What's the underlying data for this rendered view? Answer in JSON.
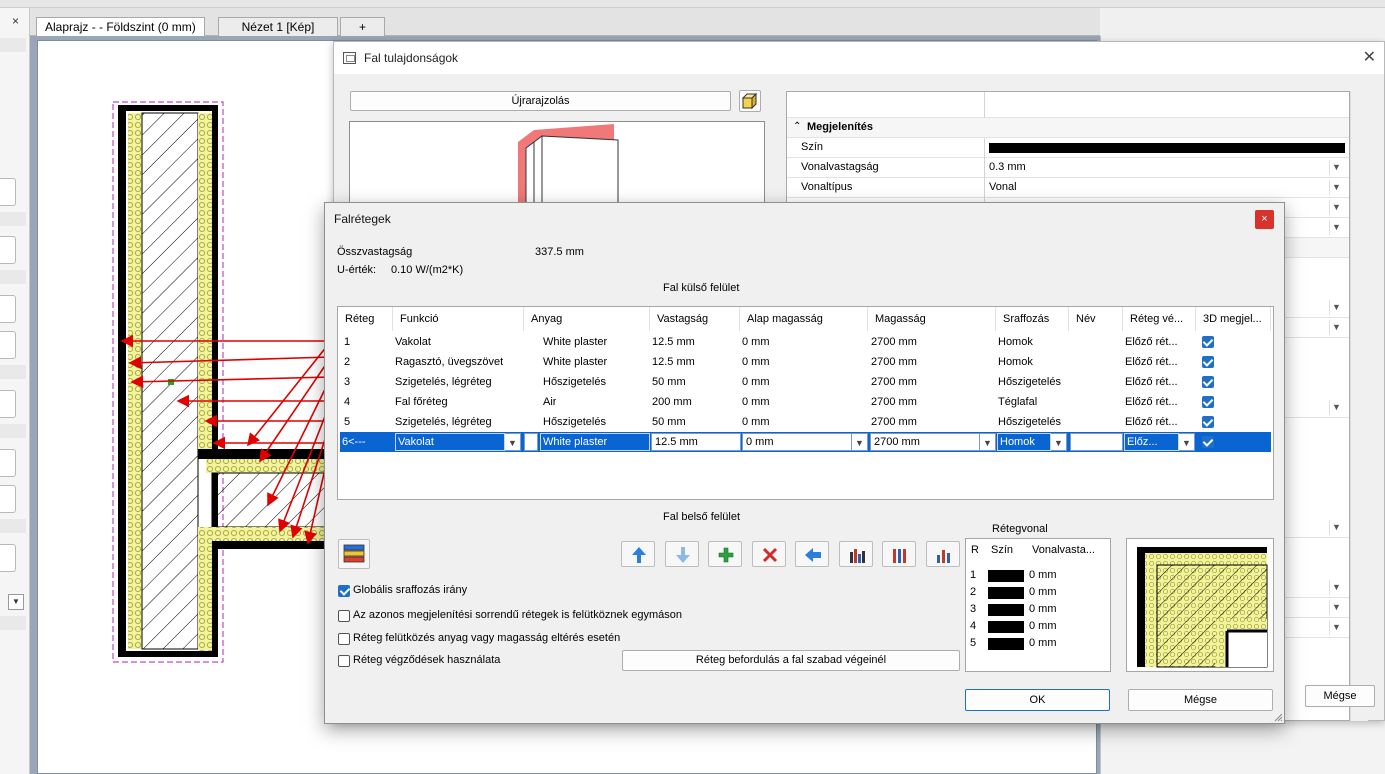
{
  "tabs": [
    {
      "label": "Alaprajz -  - Földszint (0 mm)",
      "active": true
    },
    {
      "label": "Nézet 1 [Kép]",
      "active": false
    },
    {
      "label": "+",
      "active": false
    }
  ],
  "left_panel": {
    "close_glyph": "×"
  },
  "wall_properties": {
    "title": "Fal tulajdonságok",
    "close_glyph": "✕",
    "redraw_label": "Újrarajzolás",
    "property_grid": {
      "section_display": "Megjelenítés",
      "rows": [
        {
          "key": "Szín",
          "value": ""
        },
        {
          "key": "Vonalvastagság",
          "value": "0.3 mm"
        },
        {
          "key": "Vonaltípus",
          "value": "Vonal"
        }
      ]
    },
    "cancel_label": "Mégse"
  },
  "wall_layers": {
    "title": "Falrétegek",
    "close_glyph": "×",
    "total_thickness_label": "Összvastagság",
    "total_thickness_value": "337.5 mm",
    "u_value_label": "U-érték:",
    "u_value_value": "0.10 W/(m2*K)",
    "outer_surface_label": "Fal külső felület",
    "inner_surface_label": "Fal belső felület",
    "columns": [
      "Réteg",
      "Funkció",
      "Anyag",
      "Vastagság",
      "Alap magasság",
      "Magasság",
      "Sraffozás",
      "Név",
      "Réteg vé...",
      "3D megjel..."
    ],
    "rows": [
      {
        "layer": "1",
        "function": "Vakolat",
        "material": "White plaster",
        "thickness": "12.5 mm",
        "base_height": "0 mm",
        "height": "2700 mm",
        "hatch": "Homok",
        "name": "",
        "layer_end": "Előző rét...",
        "show_3d": true
      },
      {
        "layer": "2",
        "function": "Ragasztó, üvegszövet",
        "material": "White plaster",
        "thickness": "12.5 mm",
        "base_height": "0 mm",
        "height": "2700 mm",
        "hatch": "Homok",
        "name": "",
        "layer_end": "Előző rét...",
        "show_3d": true
      },
      {
        "layer": "3",
        "function": "Szigetelés, légréteg",
        "material": "Hőszigetelés",
        "thickness": "50 mm",
        "base_height": "0 mm",
        "height": "2700 mm",
        "hatch": "Hőszigetelés",
        "name": "",
        "layer_end": "Előző rét...",
        "show_3d": true
      },
      {
        "layer": "4",
        "function": "Fal főréteg",
        "material": "Air",
        "thickness": "200 mm",
        "base_height": "0 mm",
        "height": "2700 mm",
        "hatch": "Téglafal",
        "name": "",
        "layer_end": "Előző rét...",
        "show_3d": true
      },
      {
        "layer": "5",
        "function": "Szigetelés, légréteg",
        "material": "Hőszigetelés",
        "thickness": "50 mm",
        "base_height": "0 mm",
        "height": "2700 mm",
        "hatch": "Hőszigetelés",
        "name": "",
        "layer_end": "Előző rét...",
        "show_3d": true
      },
      {
        "layer": "6<---",
        "function": "Vakolat",
        "material": "White plaster",
        "thickness": "12.5 mm",
        "base_height": "0 mm",
        "height": "2700 mm",
        "hatch": "Homok",
        "name": "",
        "layer_end": "Előz...",
        "show_3d": true,
        "selected": true
      }
    ],
    "options": [
      {
        "label": "Globális sraffozás irány",
        "checked": true
      },
      {
        "label": "Az azonos megjelenítési sorrendű rétegek is felütköznek egymáson",
        "checked": false
      },
      {
        "label": "Réteg felütközés anyag vagy magasság eltérés esetén",
        "checked": false
      },
      {
        "label": "Réteg végződések használata",
        "checked": false
      }
    ],
    "layer_turn_button": "Réteg befordulás a fal szabad végeinél",
    "layer_line": {
      "title": "Rétegvonal",
      "headers": [
        "R",
        "Szín",
        "Vonalvasta..."
      ],
      "rows": [
        {
          "r": "1",
          "width": "0 mm"
        },
        {
          "r": "2",
          "width": "0 mm"
        },
        {
          "r": "3",
          "width": "0 mm"
        },
        {
          "r": "4",
          "width": "0 mm"
        },
        {
          "r": "5",
          "width": "0 mm"
        }
      ]
    },
    "ok_label": "OK",
    "cancel_label": "Mégse"
  },
  "colors": {
    "selection": "#0a64d2",
    "arrow_red": "#e00000",
    "insulation_yellow": "#f3f39a",
    "dialog_close_red": "#d9322a"
  }
}
